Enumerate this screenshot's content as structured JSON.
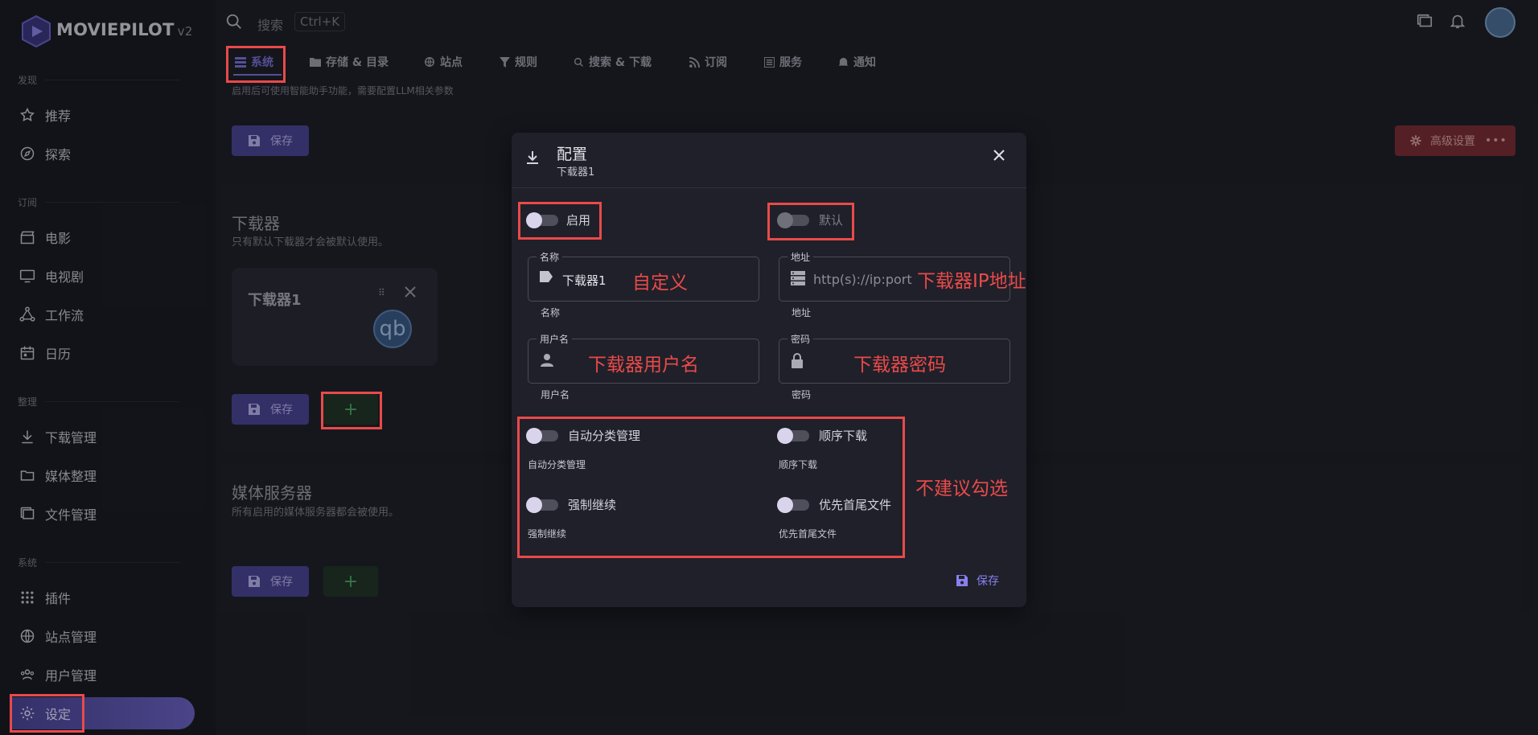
{
  "app": {
    "name": "MOVIEPILOT",
    "version": "v2"
  },
  "sidebar": {
    "sections": [
      {
        "label": "发现",
        "items": [
          {
            "label": "推荐",
            "icon": "star-icon"
          },
          {
            "label": "探索",
            "icon": "compass-icon"
          }
        ]
      },
      {
        "label": "订阅",
        "items": [
          {
            "label": "电影",
            "icon": "clapper-icon"
          },
          {
            "label": "电视剧",
            "icon": "monitor-icon"
          },
          {
            "label": "工作流",
            "icon": "workflow-icon"
          },
          {
            "label": "日历",
            "icon": "calendar-icon"
          }
        ]
      },
      {
        "label": "整理",
        "items": [
          {
            "label": "下载管理",
            "icon": "download-icon"
          },
          {
            "label": "媒体整理",
            "icon": "folder-sync-icon"
          },
          {
            "label": "文件管理",
            "icon": "files-icon"
          }
        ]
      },
      {
        "label": "系统",
        "items": [
          {
            "label": "插件",
            "icon": "grid-icon"
          },
          {
            "label": "站点管理",
            "icon": "globe-icon"
          },
          {
            "label": "用户管理",
            "icon": "users-icon"
          },
          {
            "label": "设定",
            "icon": "gear-icon",
            "active": true
          }
        ]
      }
    ]
  },
  "topbar": {
    "search_placeholder": "搜索",
    "shortcut": "Ctrl+K"
  },
  "tabs": [
    {
      "label": "系统",
      "icon": "list-icon",
      "active": true
    },
    {
      "label": "存储 & 目录",
      "icon": "folder-icon"
    },
    {
      "label": "站点",
      "icon": "globe-icon"
    },
    {
      "label": "规则",
      "icon": "filter-icon"
    },
    {
      "label": "搜索 & 下载",
      "icon": "search-icon"
    },
    {
      "label": "订阅",
      "icon": "rss-icon"
    },
    {
      "label": "服务",
      "icon": "service-icon"
    },
    {
      "label": "通知",
      "icon": "bell-icon"
    }
  ],
  "main": {
    "llm_hint": "启用后可使用智能助手功能，需要配置LLM相关参数",
    "save_label": "保存",
    "advanced_label": "高级设置",
    "downloader": {
      "title": "下载器",
      "subtitle": "只有默认下载器才会被默认使用。",
      "card_name": "下载器1",
      "card_logo": "qb"
    },
    "media_server": {
      "title": "媒体服务器",
      "subtitle": "所有启用的媒体服务器都会被使用。"
    },
    "add_label": "+"
  },
  "dialog": {
    "title": "配置",
    "subtitle": "下载器1",
    "enable_label": "启用",
    "default_label": "默认",
    "name": {
      "label": "名称",
      "value": "下载器1",
      "hint": "名称"
    },
    "host": {
      "label": "地址",
      "placeholder": "http(s)://ip:port",
      "hint": "地址"
    },
    "username": {
      "label": "用户名",
      "hint": "用户名"
    },
    "password": {
      "label": "密码",
      "hint": "密码"
    },
    "options": [
      {
        "label": "自动分类管理",
        "hint": "自动分类管理"
      },
      {
        "label": "顺序下载",
        "hint": "顺序下载"
      },
      {
        "label": "强制继续",
        "hint": "强制继续"
      },
      {
        "label": "优先首尾文件",
        "hint": "优先首尾文件"
      }
    ],
    "save_label": "保存"
  },
  "annotations": {
    "name": "自定义",
    "host": "下载器IP地址",
    "username": "下载器用户名",
    "password": "下载器密码",
    "options": "不建议勾选"
  },
  "colors": {
    "accent": "#7a73d8",
    "annotation": "#e94a4a",
    "advanced": "#7a2e35"
  }
}
